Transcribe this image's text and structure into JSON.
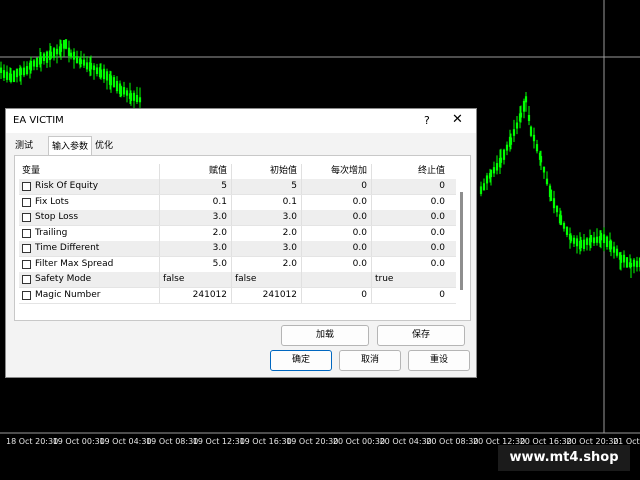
{
  "dialog": {
    "title": "EA VICTIM",
    "help_label": "?",
    "close_label": "✕",
    "tabs": [
      "测试",
      "输入参数",
      "优化"
    ],
    "active_tab": "输入参数",
    "columns": [
      "变量",
      "赋值",
      "初始值",
      "每次增加",
      "终止值"
    ],
    "rows": [
      {
        "name": "Risk Of Equity",
        "value": "5",
        "start": "5",
        "step": "0",
        "stop": "0"
      },
      {
        "name": "Fix Lots",
        "value": "0.1",
        "start": "0.1",
        "step": "0.0",
        "stop": "0.0"
      },
      {
        "name": "Stop Loss",
        "value": "3.0",
        "start": "3.0",
        "step": "0.0",
        "stop": "0.0"
      },
      {
        "name": "Trailing",
        "value": "2.0",
        "start": "2.0",
        "step": "0.0",
        "stop": "0.0"
      },
      {
        "name": "Time Different",
        "value": "3.0",
        "start": "3.0",
        "step": "0.0",
        "stop": "0.0"
      },
      {
        "name": "Filter Max Spread",
        "value": "5.0",
        "start": "2.0",
        "step": "0.0",
        "stop": "0.0"
      },
      {
        "name": "Safety Mode",
        "value": "false",
        "start": "false",
        "step": "",
        "stop": "true"
      },
      {
        "name": "Magic Number",
        "value": "241012",
        "start": "241012",
        "step": "0",
        "stop": "0"
      }
    ],
    "buttons": {
      "load": "加载",
      "save": "保存",
      "ok": "确定",
      "cancel": "取消",
      "reset": "重设"
    }
  },
  "chart": {
    "time_axis_labels": [
      "18 Oct 20:30",
      "19 Oct 00:30",
      "19 Oct 04:30",
      "19 Oct 08:30",
      "19 Oct 12:30",
      "19 Oct 16:30",
      "19 Oct 20:30",
      "20 Oct 00:30",
      "20 Oct 04:30",
      "20 Oct 08:30",
      "20 Oct 12:30",
      "20 Oct 16:30",
      "20 Oct 20:30",
      "21 Oct 00:30"
    ],
    "bull_color": "#00ff00",
    "bear_color": "#00ff00",
    "background": "#000000"
  },
  "watermark": "www.mt4.shop"
}
